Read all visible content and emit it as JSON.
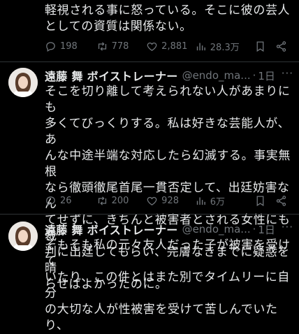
{
  "prev_tweet": {
    "lines": [
      "軽視される事に怒っている。そこに彼の芸人",
      "としての資質は関係ない。"
    ],
    "replies": "198",
    "retweets": "778",
    "likes": "2,881",
    "views": "28.3万"
  },
  "tweet1": {
    "name": "遠藤 舞 ボイストレーナー",
    "handle": "@endo_ma...",
    "dot": "·",
    "time": "1日",
    "more": "···",
    "lines": [
      "そこを切り離して考えられない人があまりにも",
      "多くてびっくりする。私は好きな芸能人が、あ",
      "んな中途半端な対応したら幻滅する。事実無根",
      "なら徹頭徹尾首尾一貫否定して、出廷妨害なん",
      "てせずに、きちんと被害者とされる女性にも裁",
      "判に出廷してもらい、完膚なきまでに疑惑を晴",
      "らせばよかったのに。"
    ],
    "replies": "26",
    "retweets": "200",
    "likes": "928",
    "views": "6万"
  },
  "tweet2": {
    "name": "遠藤 舞 ボイストレーナー",
    "handle": "@endo_ma...",
    "dot": "·",
    "time": "1日",
    "more": "···",
    "lines": [
      "そもそも私の元々友人だった子が被害を受けて",
      "いたり、この件とはまた別でタイムリーに自分",
      "の大切な人が性被害を受けて苦しんでいたり、"
    ]
  },
  "icons": {
    "reply": "reply-icon",
    "retweet": "retweet-icon",
    "like": "heart-icon",
    "views": "views-icon",
    "bookmark": "bookmark-icon",
    "share": "share-icon"
  },
  "colors": {
    "background": "#000000",
    "text": "#e7e9ea",
    "muted": "#71767b",
    "divider": "#2f3336"
  }
}
